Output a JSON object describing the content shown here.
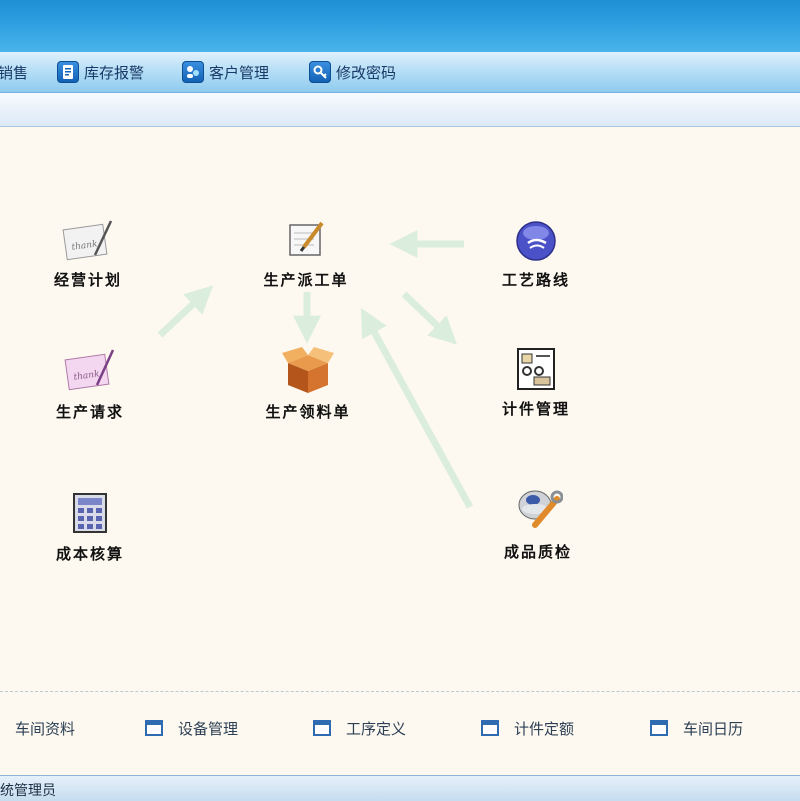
{
  "menu": {
    "items": [
      {
        "label": "销售",
        "icon": "sales-icon"
      },
      {
        "label": "库存报警",
        "icon": "inventory-alert-icon"
      },
      {
        "label": "客户管理",
        "icon": "customer-management-icon"
      },
      {
        "label": "修改密码",
        "icon": "change-password-icon"
      }
    ]
  },
  "modules": {
    "business_plan": {
      "label": "经营计划",
      "icon": "thank-you-card-icon"
    },
    "production_dispatch": {
      "label": "生产派工单",
      "icon": "notepad-pencil-icon"
    },
    "process_route": {
      "label": "工艺路线",
      "icon": "purple-orb-icon"
    },
    "production_request": {
      "label": "生产请求",
      "icon": "thank-you-card-pink-icon"
    },
    "material_requisition": {
      "label": "生产领料单",
      "icon": "package-box-icon"
    },
    "piecework_management": {
      "label": "计件管理",
      "icon": "piecework-document-icon"
    },
    "cost_accounting": {
      "label": "成本核算",
      "icon": "calculator-icon"
    },
    "quality_inspection": {
      "label": "成品质检",
      "icon": "inspection-wrench-icon"
    }
  },
  "bottom_links": [
    {
      "label": "车间资料",
      "icon": "window-icon"
    },
    {
      "label": "设备管理",
      "icon": "window-icon"
    },
    {
      "label": "工序定义",
      "icon": "window-icon"
    },
    {
      "label": "计件定额",
      "icon": "window-icon"
    },
    {
      "label": "车间日历",
      "icon": "window-icon"
    }
  ],
  "status": {
    "user_text": "统管理员"
  },
  "colors": {
    "header": "#2ea0e0",
    "menubar": "#b7dff6",
    "content_bg": "#fdf9f0",
    "flow_arrow": "#dbeedd"
  }
}
